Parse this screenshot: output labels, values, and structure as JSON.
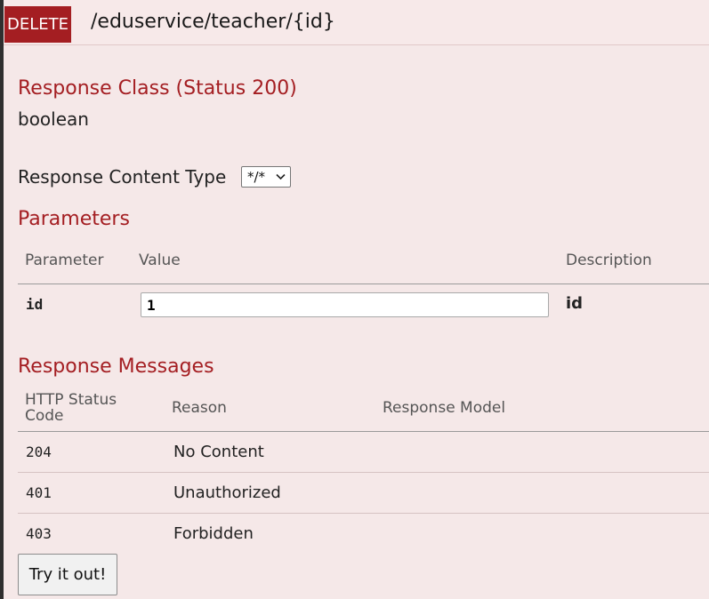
{
  "operation": {
    "method": "DELETE",
    "path": "/eduservice/teacher/{id}"
  },
  "response_class": {
    "title": "Response Class (Status 200)",
    "type": "boolean"
  },
  "content_type": {
    "label": "Response Content Type",
    "selected": "*/*"
  },
  "parameters": {
    "title": "Parameters",
    "columns": [
      "Parameter",
      "Value",
      "Description"
    ],
    "rows": [
      {
        "name": "id",
        "value": "1",
        "description": "id"
      }
    ]
  },
  "response_messages": {
    "title": "Response Messages",
    "columns": [
      "HTTP Status Code",
      "Reason",
      "Response Model"
    ],
    "rows": [
      {
        "code": "204",
        "reason": "No Content",
        "model": ""
      },
      {
        "code": "401",
        "reason": "Unauthorized",
        "model": ""
      },
      {
        "code": "403",
        "reason": "Forbidden",
        "model": ""
      }
    ]
  },
  "actions": {
    "try_label": "Try it out!"
  },
  "colors": {
    "method_badge": "#a41e22",
    "section_title": "#a41e22",
    "panel_background": "#f5e8e8"
  }
}
